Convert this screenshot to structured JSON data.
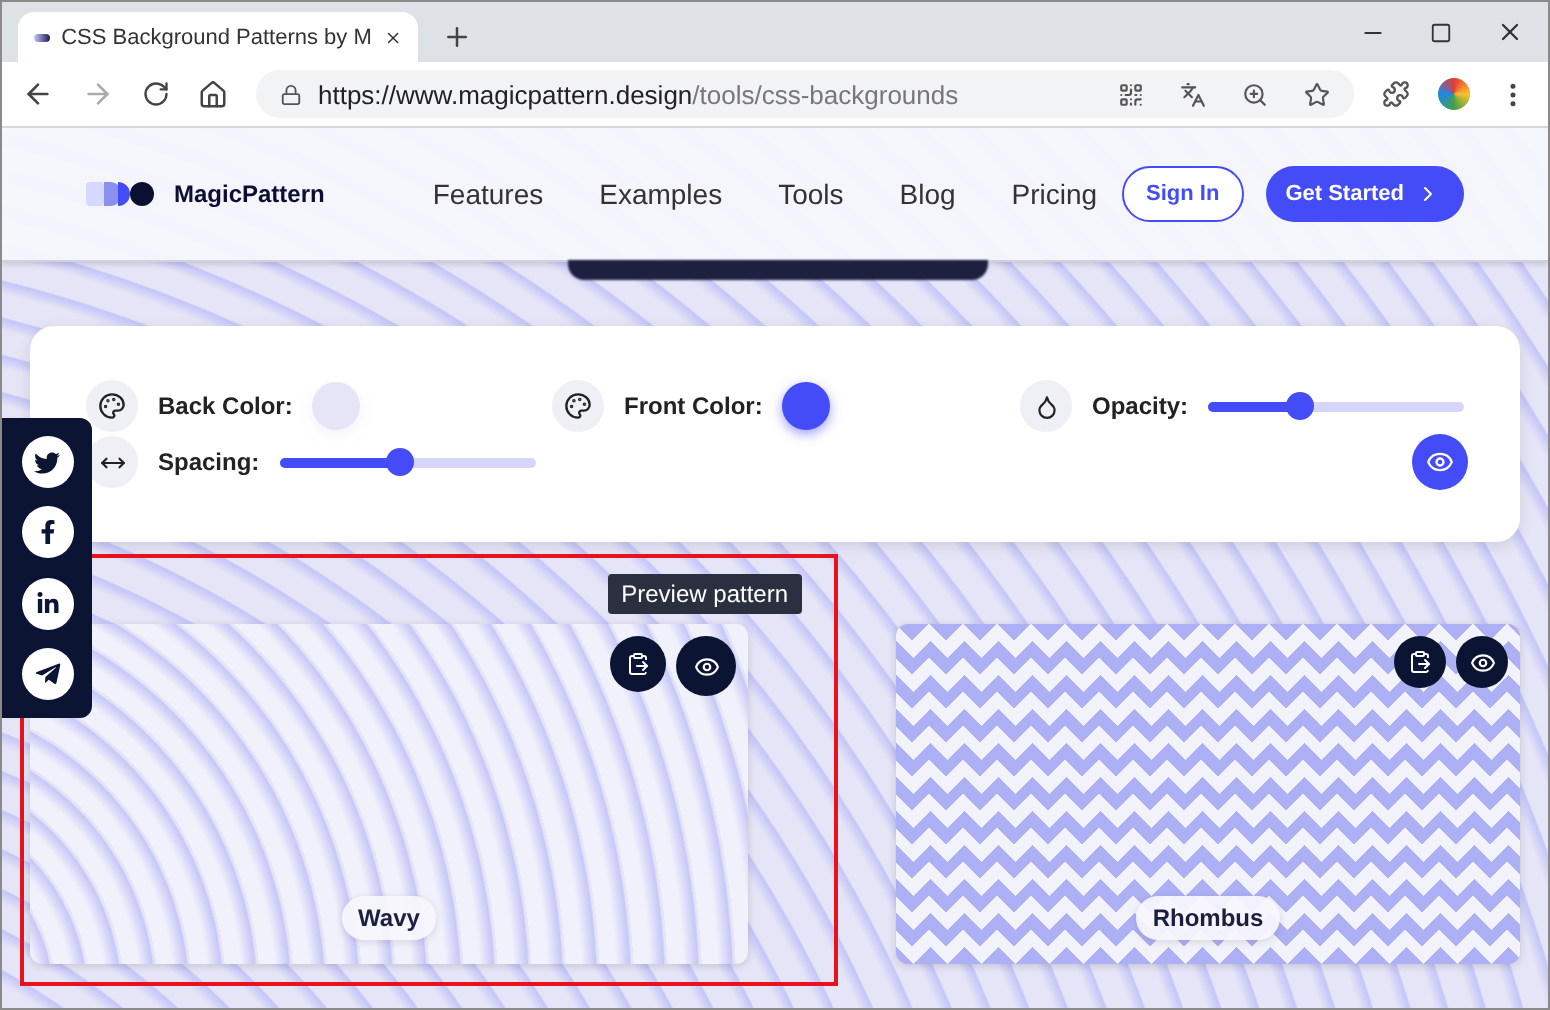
{
  "browser": {
    "tab_title": "CSS Background Patterns by M",
    "url_host": "https://www.magicpattern.design",
    "url_path": "/tools/css-backgrounds"
  },
  "nav": {
    "logo": "MagicPattern",
    "links": [
      "Features",
      "Examples",
      "Tools",
      "Blog",
      "Pricing"
    ],
    "sign_in": "Sign In",
    "get_started": "Get Started"
  },
  "controls": [
    {
      "kind": "color",
      "label": "Back Color:",
      "color": "#e5e5f7"
    },
    {
      "kind": "color",
      "label": "Front Color:",
      "color": "#444cf7"
    },
    {
      "kind": "slider",
      "label": "Opacity:",
      "level": 0.36
    },
    {
      "kind": "slider",
      "label": "Spacing:",
      "level": 0.47
    }
  ],
  "tooltip": "Preview pattern",
  "patterns": [
    {
      "name": "Wavy",
      "kind": "wavy",
      "highlighted": true
    },
    {
      "name": "Rhombus",
      "kind": "rhombus",
      "highlighted": false
    }
  ]
}
